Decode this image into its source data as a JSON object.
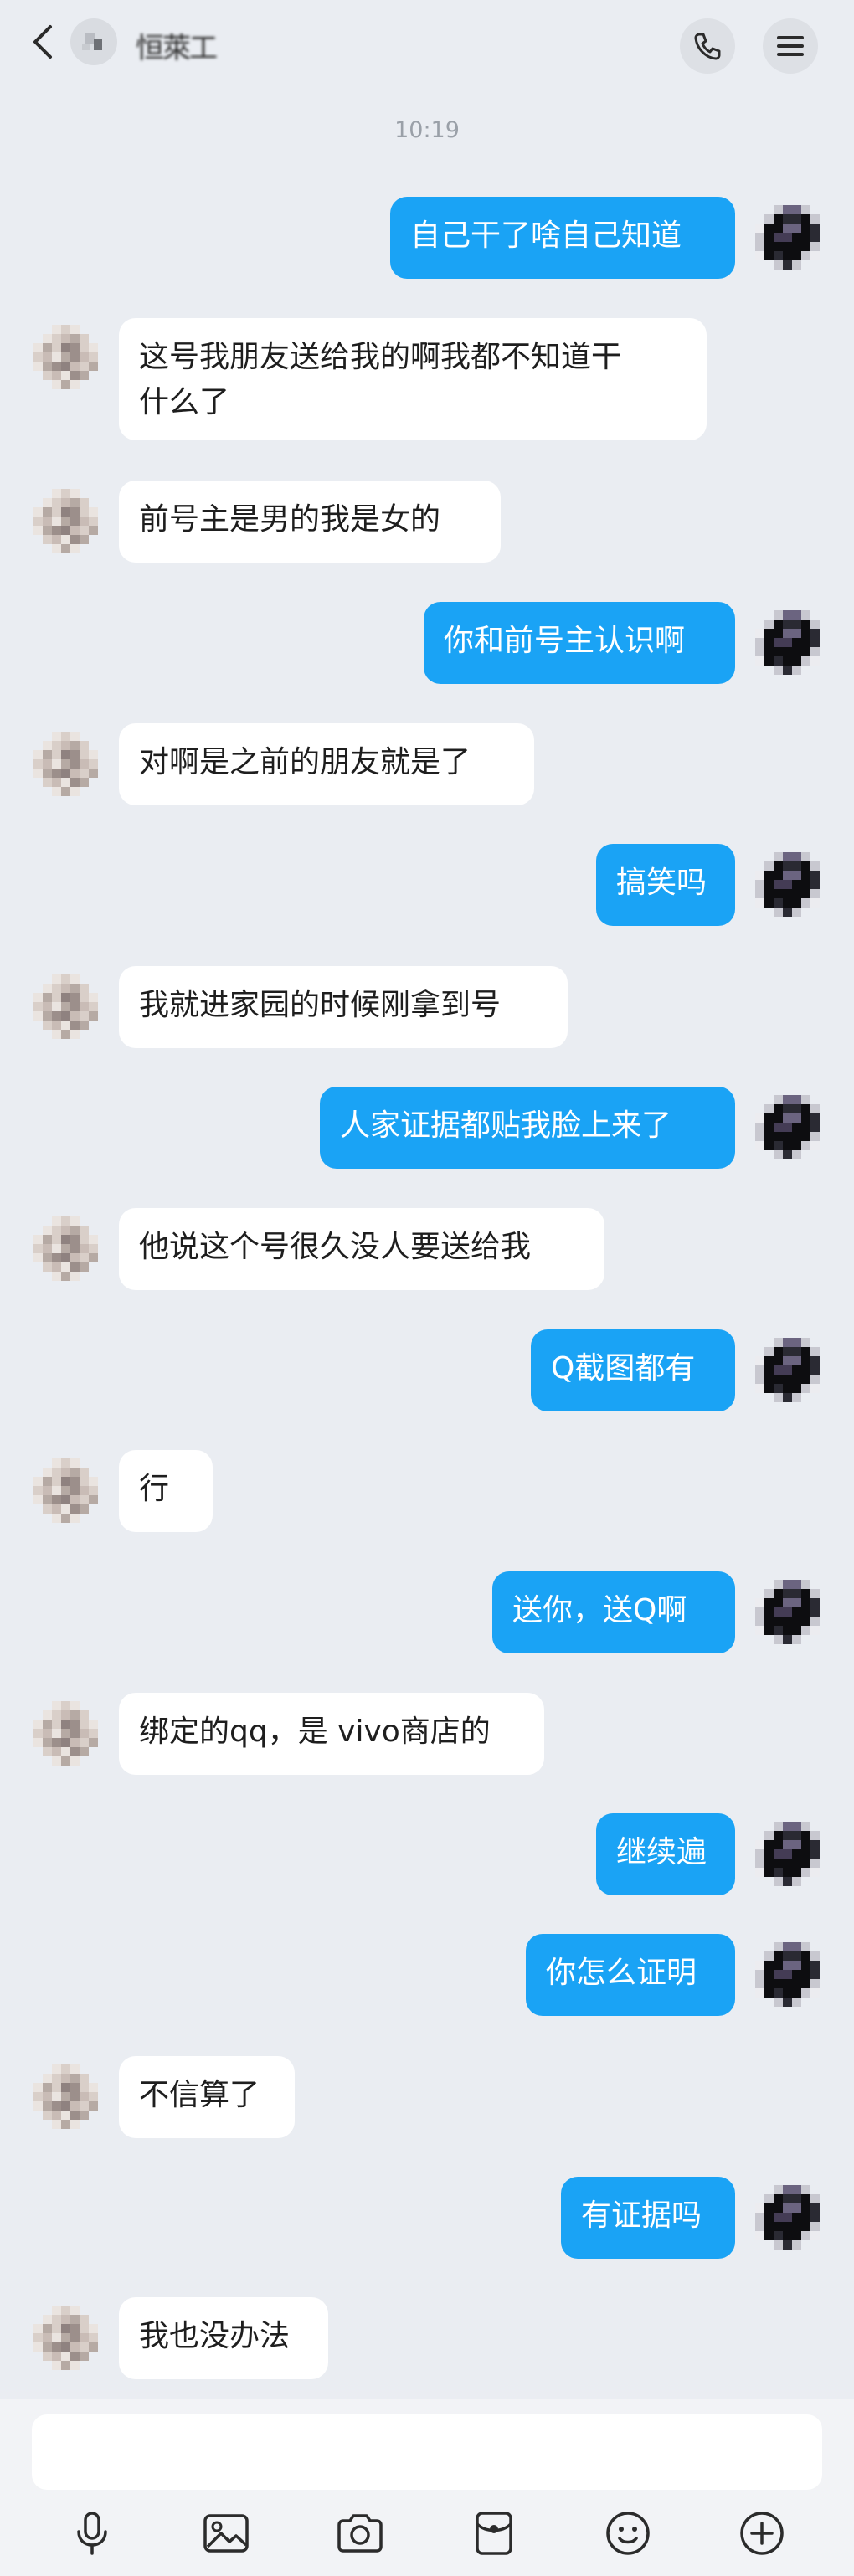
{
  "header": {
    "name": "恒萊工",
    "back_icon": "chevron-left-icon",
    "call_icon": "phone-icon",
    "menu_icon": "hamburger-menu-icon"
  },
  "timestamp": "10:19",
  "messages": [
    {
      "from": "me",
      "text": "自己干了啥自己知道"
    },
    {
      "from": "them",
      "text": "这号我朋友送给我的啊我都不知道干\n什么了"
    },
    {
      "from": "them",
      "text": "前号主是男的我是女的"
    },
    {
      "from": "me",
      "text": "你和前号主认识啊"
    },
    {
      "from": "them",
      "text": "对啊是之前的朋友就是了"
    },
    {
      "from": "me",
      "text": "搞笑吗"
    },
    {
      "from": "them",
      "text": "我就进家园的时候刚拿到号"
    },
    {
      "from": "me",
      "text": "人家证据都贴我脸上来了"
    },
    {
      "from": "them",
      "text": "他说这个号很久没人要送给我"
    },
    {
      "from": "me",
      "text": "Q截图都有"
    },
    {
      "from": "them",
      "text": "行"
    },
    {
      "from": "me",
      "text": "送你，送Q啊"
    },
    {
      "from": "them",
      "text": "绑定的qq，是 vivo商店的"
    },
    {
      "from": "me",
      "text": "继续遍"
    },
    {
      "from": "me",
      "text": "你怎么证明"
    },
    {
      "from": "them",
      "text": "不信算了"
    },
    {
      "from": "me",
      "text": "有证据吗"
    },
    {
      "from": "them",
      "text": "我也没办法"
    }
  ],
  "input": {
    "value": "",
    "placeholder": ""
  },
  "toolbar": [
    {
      "icon": "microphone-icon"
    },
    {
      "icon": "image-icon"
    },
    {
      "icon": "camera-icon"
    },
    {
      "icon": "red-packet-icon"
    },
    {
      "icon": "emoji-icon"
    },
    {
      "icon": "plus-icon"
    }
  ],
  "colors": {
    "background": "#eaedf2",
    "my_bubble": "#1aa3f5",
    "their_bubble": "#ffffff"
  }
}
